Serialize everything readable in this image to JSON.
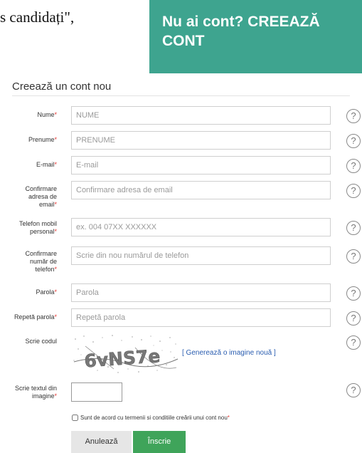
{
  "doc_text": "s candidați\",",
  "cta": {
    "line1": "Nu ai cont? CREEAZĂ",
    "line2": "CONT"
  },
  "form": {
    "title": "Creează un cont nou",
    "fields": {
      "nume": {
        "label": "Nume",
        "placeholder": "NUME"
      },
      "prenume": {
        "label": "Prenume",
        "placeholder": "PRENUME"
      },
      "email": {
        "label": "E-mail",
        "placeholder": "E-mail"
      },
      "email_confirm": {
        "label_lines": [
          "Confirmare",
          "adresa de",
          "email"
        ],
        "placeholder": "Confirmare adresa de email"
      },
      "phone": {
        "label_lines": [
          "Telefon mobil",
          "personal"
        ],
        "placeholder": "ex. 004 07XX XXXXXX"
      },
      "phone_confirm": {
        "label_lines": [
          "Confirmare",
          "număr de",
          "telefon"
        ],
        "placeholder": "Scrie din nou numărul de telefon"
      },
      "password": {
        "label": "Parola",
        "placeholder": "Parola"
      },
      "password_repeat": {
        "label": "Repetă parola",
        "placeholder": "Repetă parola"
      },
      "code": {
        "label": "Scrie codul",
        "captcha_text": "6vNS7e",
        "generate_link": "[ Generează o imagine nouă ]"
      },
      "captcha_answer": {
        "label_lines": [
          "Scrie textul din",
          "imagine"
        ],
        "value": ""
      }
    },
    "required_marker": "*",
    "help_glyph": "?",
    "terms": "Sunt de acord cu termenii si conditiile creării unui cont nou",
    "terms_checked": false,
    "buttons": {
      "cancel": "Anulează",
      "submit": "Înscrie"
    }
  },
  "colors": {
    "cta_bg": "#3ea48f",
    "submit_bg": "#3fa45a",
    "required": "#e53935",
    "link": "#2a5db0"
  },
  "icons": {
    "help": "question-circle-icon"
  }
}
